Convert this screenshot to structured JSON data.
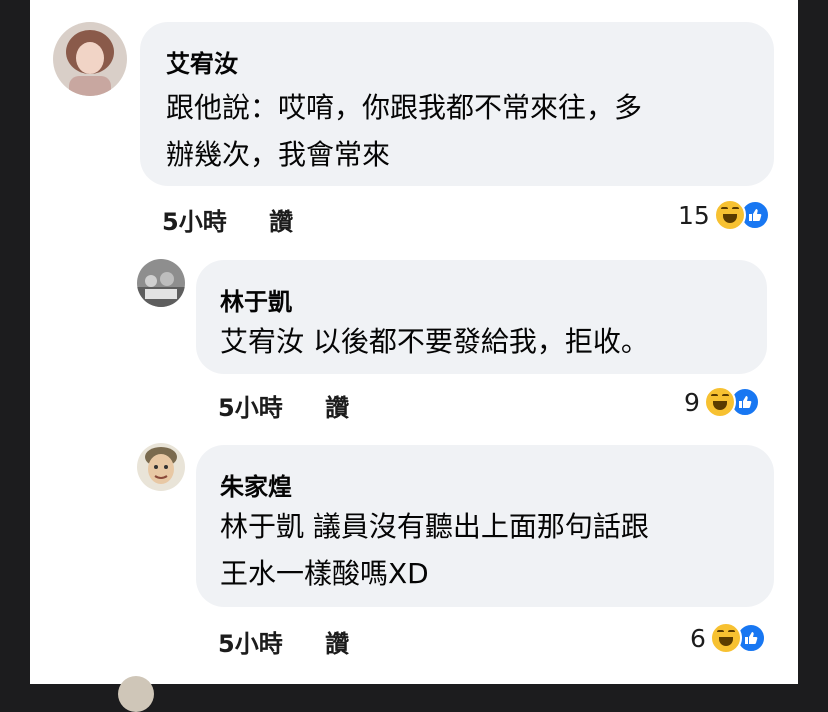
{
  "comments": [
    {
      "author": "艾宥汝",
      "lines": [
        "跟他說：哎唷，你跟我都不常來往，多",
        "辦幾次，我會常來"
      ],
      "time": "5小時",
      "like_label": "讚",
      "reaction_count": "15"
    },
    {
      "author": "林于凱",
      "lines": [
        "艾宥汝 以後都不要發給我，拒收。"
      ],
      "time": "5小時",
      "like_label": "讚",
      "reaction_count": "9"
    },
    {
      "author": "朱家煌",
      "lines": [
        "林于凱 議員沒有聽出上面那句話跟",
        "王水一樣酸嗎XD"
      ],
      "time": "5小時",
      "like_label": "讚",
      "reaction_count": "6"
    }
  ],
  "icons": {
    "reaction_primary": "haha-emoji-icon",
    "reaction_secondary": "like-thumb-icon"
  },
  "colors": {
    "bubble": "#f0f2f5",
    "like_blue": "#1877f2",
    "haha_yellow": "#f7c131"
  }
}
